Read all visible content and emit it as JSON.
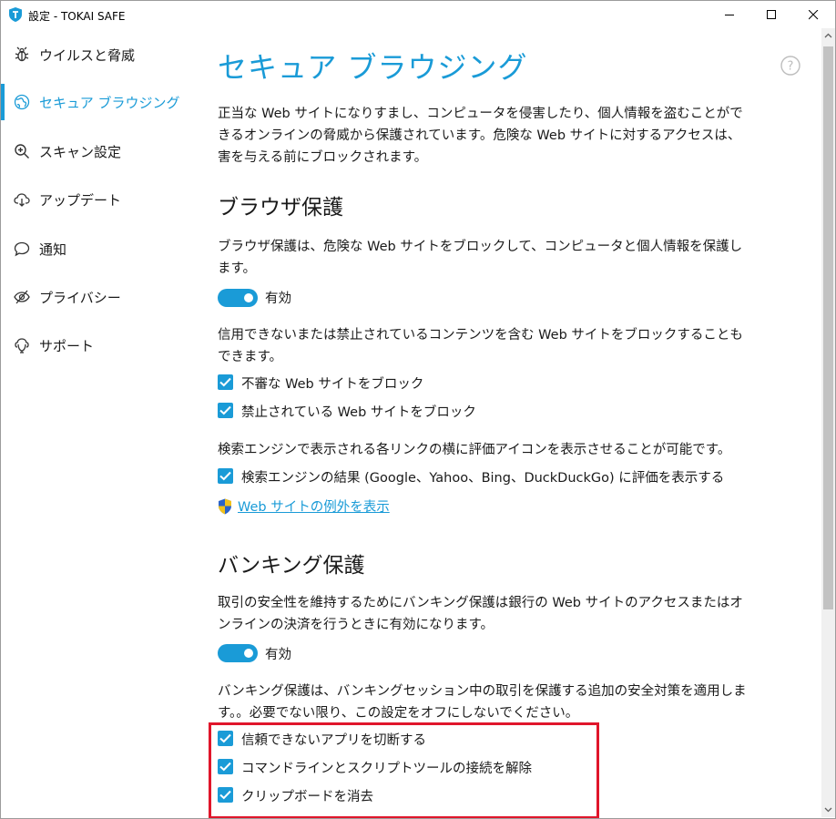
{
  "window": {
    "title": "設定 - TOKAI SAFE"
  },
  "sidebar": {
    "items": [
      {
        "label": "ウイルスと脅威",
        "icon": "bug-icon"
      },
      {
        "label": "セキュア ブラウジング",
        "icon": "globe-icon",
        "active": true
      },
      {
        "label": "スキャン設定",
        "icon": "scan-icon"
      },
      {
        "label": "アップデート",
        "icon": "cloud-download-icon"
      },
      {
        "label": "通知",
        "icon": "chat-bubble-icon"
      },
      {
        "label": "プライバシー",
        "icon": "eye-slash-icon"
      },
      {
        "label": "サポート",
        "icon": "support-icon"
      }
    ]
  },
  "main": {
    "title": "セキュア ブラウジング",
    "intro_line1": "正当な Web サイトになりすまし、コンピュータを侵害したり、個人情報を盗むことがで",
    "intro_line2": "きるオンラインの脅威から保護されています。危険な Web サイトに対するアクセスは、",
    "intro_line3": "害を与える前にブロックされます。",
    "browser": {
      "title": "ブラウザ保護",
      "desc_line1": "ブラウザ保護は、危険な Web サイトをブロックして、コンピュータと個人情報を保護し",
      "desc_line2": "ます。",
      "toggle_label": "有効",
      "toggle_on": true,
      "block_desc_line1": "信用できないまたは禁止されているコンテンツを含む Web サイトをブロックすることも",
      "block_desc_line2": "できます。",
      "chk_suspicious": "不審な Web サイトをブロック",
      "chk_forbidden": "禁止されている Web サイトをブロック",
      "rating_desc": "検索エンジンで表示される各リンクの横に評価アイコンを表示させることが可能です。",
      "chk_rating": "検索エンジンの結果 (Google、Yahoo、Bing、DuckDuckGo) に評価を表示する",
      "exceptions_link": "Web サイトの例外を表示"
    },
    "banking": {
      "title": "バンキング保護",
      "desc_line1": "取引の安全性を維持するためにバンキング保護は銀行の Web サイトのアクセスまたはオ",
      "desc_line2": "ンラインの決済を行うときに有効になります。",
      "toggle_label": "有効",
      "toggle_on": true,
      "extra_desc_line1": "バンキング保護は、バンキングセッション中の取引を保護する追加の安全対策を適用しま",
      "extra_desc_line2": "す。。必要でない限り、この設定をオフにしないでください。",
      "chk_untrusted": "信頼できないアプリを切断する",
      "chk_cmdline": "コマンドラインとスクリプトツールの接続を解除",
      "chk_clipboard": "クリップボードを消去"
    }
  },
  "colors": {
    "accent": "#1a9bd7",
    "highlight": "#e0162b"
  }
}
